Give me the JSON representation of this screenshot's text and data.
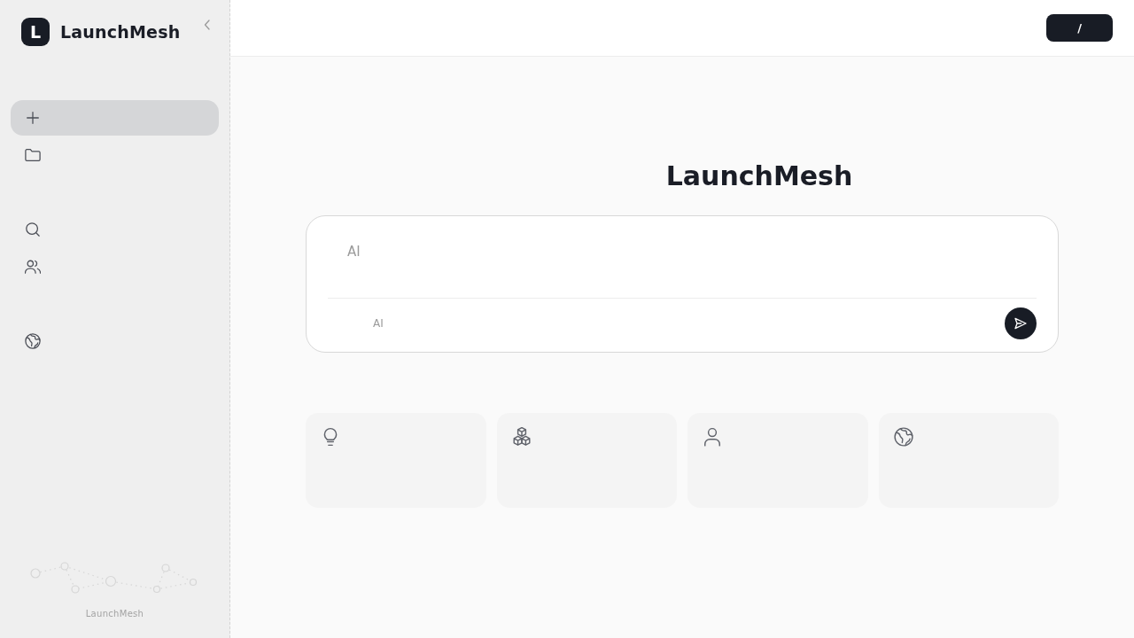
{
  "sidebar": {
    "logo": {
      "mark": "L",
      "name": "LaunchMesh"
    },
    "nav_groups": [
      {
        "items": [
          {
            "kind": "plus",
            "selected": true
          },
          {
            "kind": "folder",
            "selected": false
          }
        ]
      },
      {
        "items": [
          {
            "kind": "search",
            "selected": false
          },
          {
            "kind": "users",
            "selected": false
          }
        ]
      },
      {
        "items": [
          {
            "kind": "globe",
            "selected": false
          }
        ]
      }
    ],
    "footer": {
      "caption": "LaunchMesh"
    }
  },
  "header": {
    "button": "/"
  },
  "main": {
    "title": "LaunchMesh",
    "composer": {
      "placeholder": "AI",
      "hint": "AI"
    },
    "cards": [
      {
        "kind": "bulb"
      },
      {
        "kind": "cubes"
      },
      {
        "kind": "person"
      },
      {
        "kind": "globe"
      }
    ]
  }
}
